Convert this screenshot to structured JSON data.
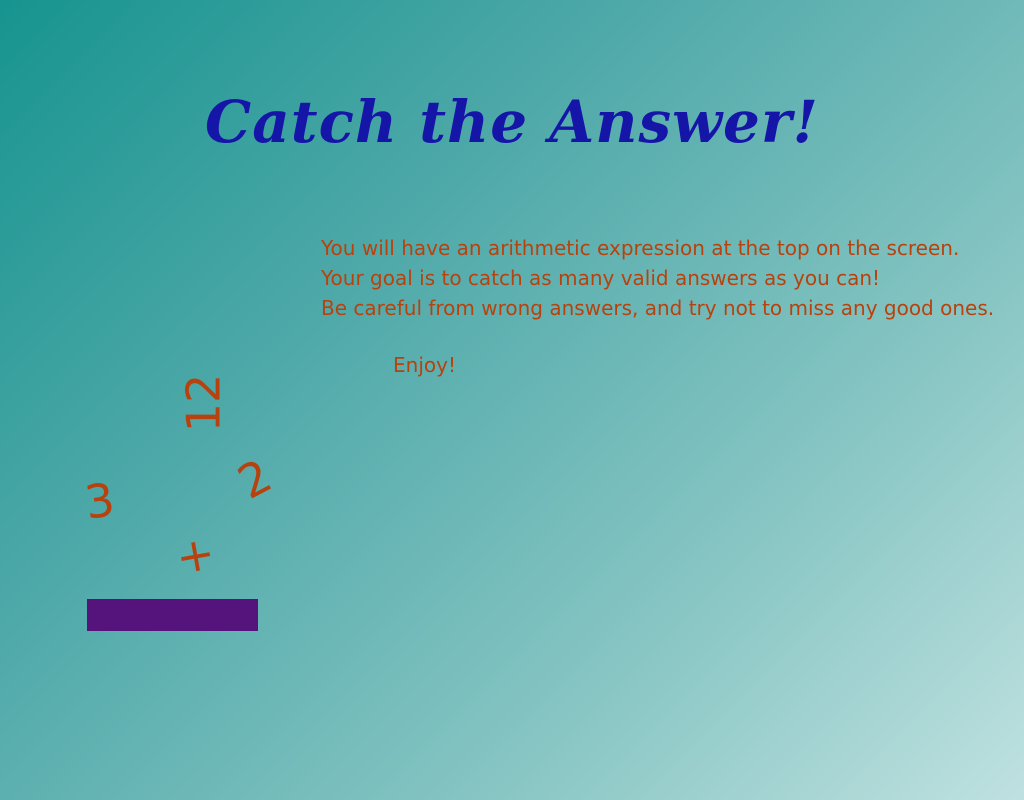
{
  "title": "Catch the Answer!",
  "instructions": {
    "line1": "You will have an arithmetic expression at the top on the screen.",
    "line2": "Your goal is to catch as many valid answers as you can!",
    "line3": "Be careful from wrong answers, and try not to miss any good ones.",
    "closing": "Enjoy!"
  },
  "falling_items": [
    {
      "text": "12"
    },
    {
      "text": "2"
    },
    {
      "text": "3"
    },
    {
      "text": "+"
    }
  ],
  "colors": {
    "title": "#1515a8",
    "text": "#b8420e",
    "paddle": "#55137c",
    "background_start": "#17948f",
    "background_end": "#bfe1e0"
  }
}
